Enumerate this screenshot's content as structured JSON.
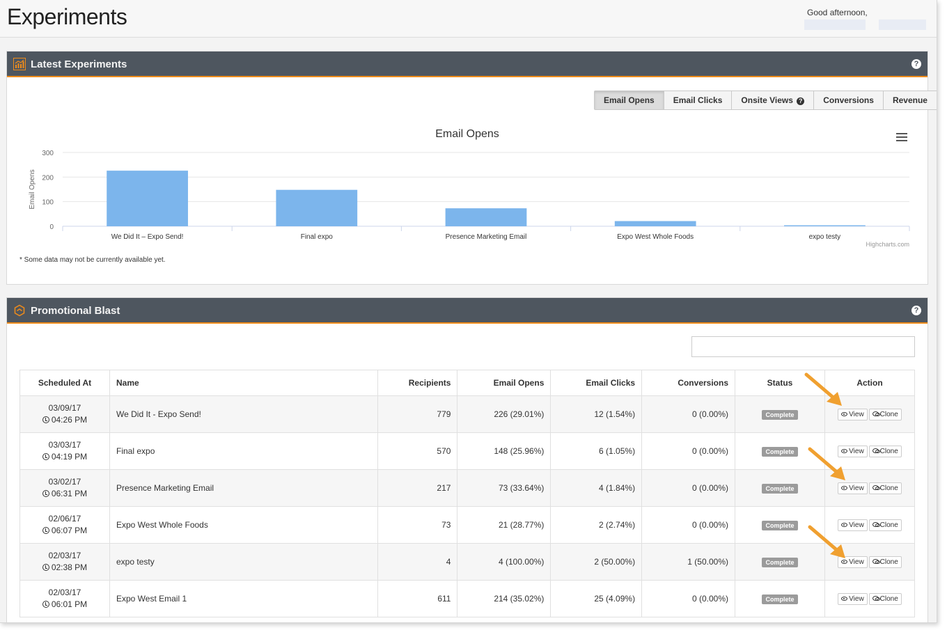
{
  "page": {
    "title": "Experiments",
    "greeting": "Good afternoon,"
  },
  "latest": {
    "title": "Latest Experiments",
    "help": "?",
    "tabs": [
      {
        "label": "Email Opens",
        "active": true
      },
      {
        "label": "Email Clicks",
        "active": false
      },
      {
        "label": "Onsite Views",
        "active": false,
        "has_help_icon": true
      },
      {
        "label": "Conversions",
        "active": false
      },
      {
        "label": "Revenue",
        "active": false
      }
    ],
    "note": "* Some data may not be currently available yet.",
    "credit": "Highcharts.com",
    "menu_icon": "hamburger-icon"
  },
  "chart_data": {
    "type": "bar",
    "title": "Email Opens",
    "ylabel": "Email Opens",
    "xlabel": "",
    "ylim": [
      0,
      300
    ],
    "yticks": [
      0,
      100,
      200,
      300
    ],
    "categories": [
      "We Did It – Expo Send!",
      "Final expo",
      "Presence Marketing Email",
      "Expo West Whole Foods",
      "expo testy"
    ],
    "values": [
      226,
      148,
      73,
      21,
      4
    ],
    "color": "#7cb5ec",
    "grid": true,
    "legend": "none"
  },
  "blast": {
    "title": "Promotional Blast",
    "help": "?",
    "search_placeholder": "",
    "columns": [
      "Scheduled At",
      "Name",
      "Recipients",
      "Email Opens",
      "Email Clicks",
      "Conversions",
      "Status",
      "Action"
    ],
    "rows": [
      {
        "date": "03/09/17",
        "time": "04:26 PM",
        "name": "We Did It - Expo Send!",
        "recipients": "779",
        "opens": "226 (29.01%)",
        "clicks": "12 (1.54%)",
        "conversions": "0 (0.00%)",
        "status": "Complete",
        "view": "View",
        "clone": "Clone"
      },
      {
        "date": "03/03/17",
        "time": "04:19 PM",
        "name": "Final expo",
        "recipients": "570",
        "opens": "148 (25.96%)",
        "clicks": "6 (1.05%)",
        "conversions": "0 (0.00%)",
        "status": "Complete",
        "view": "View",
        "clone": "Clone"
      },
      {
        "date": "03/02/17",
        "time": "06:31 PM",
        "name": "Presence Marketing Email",
        "recipients": "217",
        "opens": "73 (33.64%)",
        "clicks": "4 (1.84%)",
        "conversions": "0 (0.00%)",
        "status": "Complete",
        "view": "View",
        "clone": "Clone"
      },
      {
        "date": "02/06/17",
        "time": "06:07 PM",
        "name": "Expo West Whole Foods",
        "recipients": "73",
        "opens": "21 (28.77%)",
        "clicks": "2 (2.74%)",
        "conversions": "0 (0.00%)",
        "status": "Complete",
        "view": "View",
        "clone": "Clone"
      },
      {
        "date": "02/03/17",
        "time": "02:38 PM",
        "name": "expo testy",
        "recipients": "4",
        "opens": "4 (100.00%)",
        "clicks": "2 (50.00%)",
        "conversions": "1 (50.00%)",
        "status": "Complete",
        "view": "View",
        "clone": "Clone"
      },
      {
        "date": "02/03/17",
        "time": "06:01 PM",
        "name": "Expo West Email 1",
        "recipients": "611",
        "opens": "214 (35.02%)",
        "clicks": "25 (4.09%)",
        "conversions": "0 (0.00%)",
        "status": "Complete",
        "view": "View",
        "clone": "Clone"
      }
    ]
  },
  "colors": {
    "header_bg": "#4e565f",
    "accent": "#f08c1a",
    "bar": "#7cb5ec",
    "badge": "#9b9b9b"
  }
}
